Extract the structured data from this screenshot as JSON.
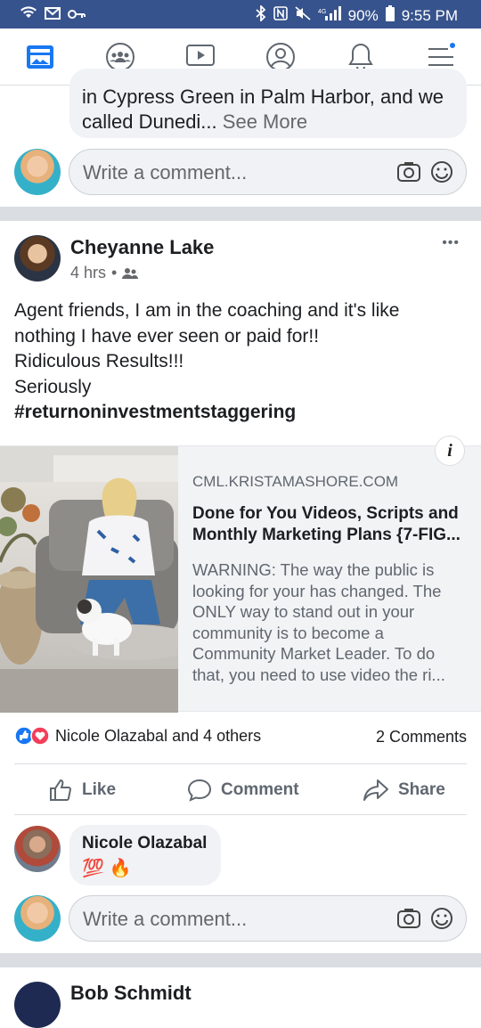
{
  "status_bar": {
    "battery": "90%",
    "time": "9:55 PM"
  },
  "nav": {
    "items": [
      "news-feed",
      "groups",
      "watch",
      "profile",
      "notifications",
      "menu"
    ]
  },
  "prev_comment": {
    "text": "in Cypress Green in Palm Harbor, and we called Dunedi...",
    "see_more": "See More"
  },
  "comment_input": {
    "placeholder": "Write a comment..."
  },
  "post": {
    "author": "Cheyanne Lake",
    "time": "4 hrs",
    "more": "•••",
    "text_lines": [
      "Agent friends, I am in the coaching and it's like",
      "nothing I have ever seen or paid for!!",
      "Ridiculous Results!!!",
      "Seriously"
    ],
    "hashtag": "#returnoninvestmentstaggering",
    "link": {
      "domain": "CML.KRISTAMASHORE.COM",
      "title": "Done for You Videos, Scripts and Monthly Marketing Plans {7-FIG...",
      "description": "WARNING: The way the public is looking for your has changed. The ONLY way to stand out in your community is to become a Community Market Leader. To do that, you need to use video the ri...",
      "info": "i"
    },
    "reactions": {
      "summary": "Nicole Olazabal and 4 others",
      "comments": "2 Comments"
    },
    "actions": {
      "like": "Like",
      "comment": "Comment",
      "share": "Share"
    }
  },
  "reply": {
    "author": "Nicole Olazabal",
    "text": "💯 🔥"
  },
  "next_post": {
    "author": "Bob Schmidt"
  },
  "colors": {
    "status_bar": "#37538d",
    "fb_blue": "#1877f2",
    "love_red": "#f33e58"
  }
}
